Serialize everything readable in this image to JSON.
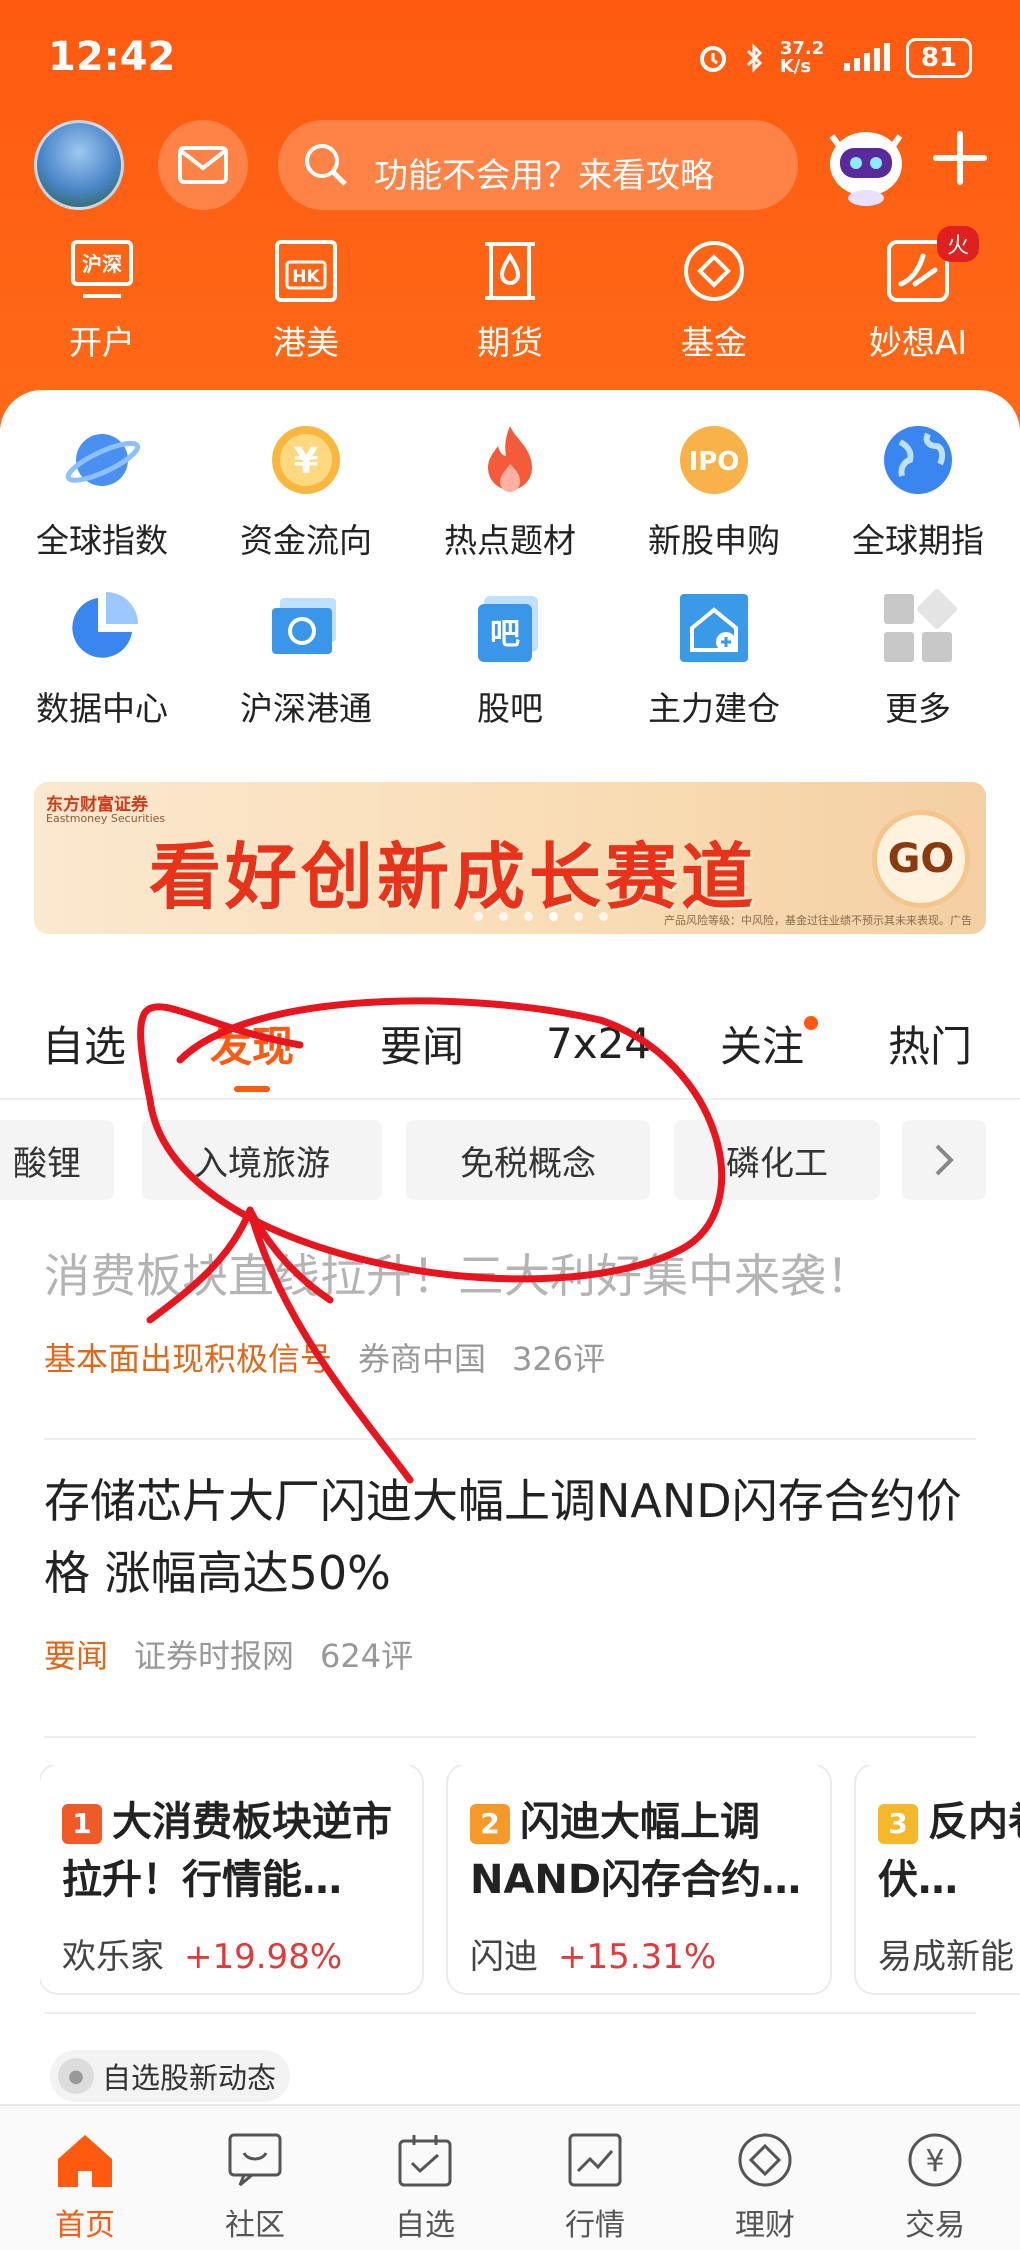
{
  "status": {
    "time": "12:42",
    "net_speed": "37.2 K/s",
    "battery": "81"
  },
  "search": {
    "placeholder": "功能不会用？来看攻略"
  },
  "top_nav": [
    {
      "label": "开户",
      "icon": "hushen-account-icon"
    },
    {
      "label": "港美",
      "icon": "hk-us-icon"
    },
    {
      "label": "期货",
      "icon": "futures-icon"
    },
    {
      "label": "基金",
      "icon": "fund-icon"
    },
    {
      "label": "妙想AI",
      "icon": "ai-icon",
      "badge": "火"
    }
  ],
  "grid": [
    {
      "label": "全球指数",
      "icon": "planet-icon"
    },
    {
      "label": "资金流向",
      "icon": "yuan-coin-icon"
    },
    {
      "label": "热点题材",
      "icon": "flame-icon"
    },
    {
      "label": "新股申购",
      "icon": "ipo-icon"
    },
    {
      "label": "全球期指",
      "icon": "globe-icon"
    },
    {
      "label": "数据中心",
      "icon": "pie-chart-icon"
    },
    {
      "label": "沪深港通",
      "icon": "hk-flag-icon"
    },
    {
      "label": "股吧",
      "icon": "guba-icon"
    },
    {
      "label": "主力建仓",
      "icon": "house-plus-icon"
    },
    {
      "label": "更多",
      "icon": "more-grid-icon"
    }
  ],
  "banner": {
    "brand": "东方财富证券",
    "brand_en": "Eastmoney Securities",
    "slogan": "看好创新成长赛道",
    "go": "GO",
    "risk": "产品风险等级：中风险，基金过往业绩不预示其未来表现。广告"
  },
  "tabs": [
    "自选",
    "发现",
    "要闻",
    "7x24",
    "关注",
    "热门"
  ],
  "active_tab": "发现",
  "chips": [
    "酸锂",
    "入境旅游",
    "免税概念",
    "磷化工"
  ],
  "news": [
    {
      "title": "消费板块直线拉升！三大利好集中来袭！",
      "tag": "基本面出现积极信号",
      "source": "券商中国",
      "comments": "326评"
    },
    {
      "title": "存储芯片大厂闪迪大幅上调NAND闪存合约价格 涨幅高达50%",
      "tag": "要闻",
      "source": "证券时报网",
      "comments": "624评"
    }
  ],
  "hot_cards": [
    {
      "rank": "1",
      "title": "大消费板块逆市拉升！行情能…",
      "stock": "欢乐家",
      "change": "+19.98%",
      "color": "#f05a28"
    },
    {
      "rank": "2",
      "title": "闪迪大幅上调NAND闪存合约…",
      "stock": "闪迪",
      "change": "+15.31%",
      "color": "#f59a28"
    },
    {
      "rank": "3",
      "title": "反内卷进展？光伏…",
      "stock": "易成新能",
      "change": "",
      "color": "#f5b828"
    }
  ],
  "dynamics_label": "自选股新动态",
  "bottom_nav": [
    {
      "label": "首页",
      "icon": "home-icon"
    },
    {
      "label": "社区",
      "icon": "community-icon"
    },
    {
      "label": "自选",
      "icon": "watchlist-icon"
    },
    {
      "label": "行情",
      "icon": "market-icon"
    },
    {
      "label": "理财",
      "icon": "wealth-icon"
    },
    {
      "label": "交易",
      "icon": "trade-icon"
    }
  ],
  "colors": {
    "brand": "#ff5a10",
    "annotation": "#e8141e",
    "up": "#e23a3a"
  }
}
